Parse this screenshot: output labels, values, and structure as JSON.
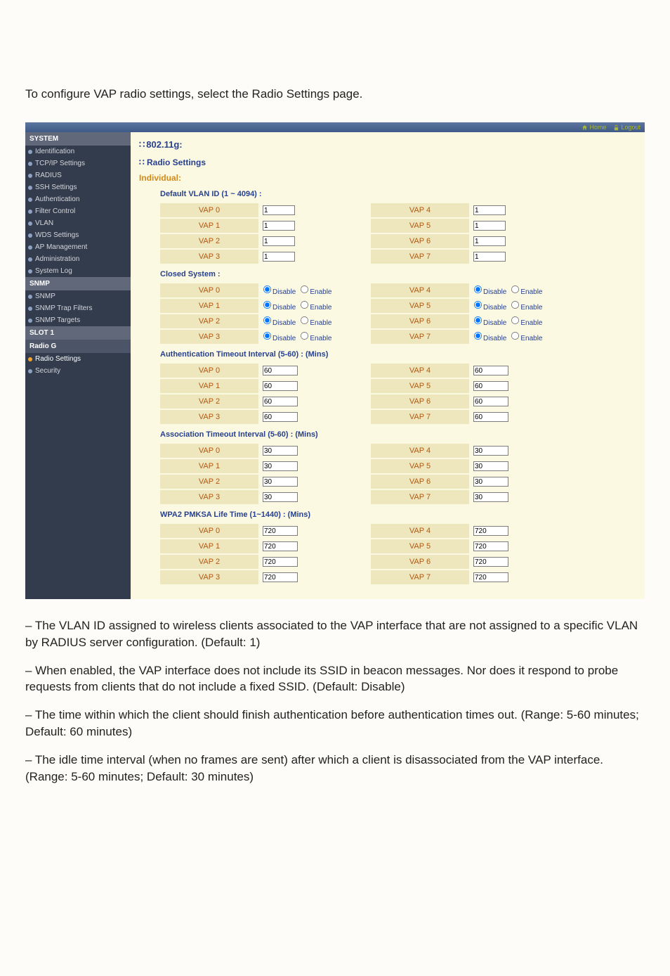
{
  "intro": "To configure VAP radio settings, select the Radio Settings page.",
  "topnav": {
    "home": "Home",
    "logout": "Logout"
  },
  "sidebar": {
    "groups": [
      {
        "name": "SYSTEM",
        "items": [
          {
            "label": "Identification"
          },
          {
            "label": "TCP/IP Settings"
          },
          {
            "label": "RADIUS"
          },
          {
            "label": "SSH Settings"
          },
          {
            "label": "Authentication"
          },
          {
            "label": "Filter Control"
          },
          {
            "label": "VLAN"
          },
          {
            "label": "WDS Settings"
          },
          {
            "label": "AP Management"
          },
          {
            "label": "Administration"
          },
          {
            "label": "System Log"
          }
        ]
      },
      {
        "name": "SNMP",
        "items": [
          {
            "label": "SNMP"
          },
          {
            "label": "SNMP Trap Filters"
          },
          {
            "label": "SNMP Targets"
          }
        ]
      },
      {
        "name": "SLOT 1",
        "items": []
      },
      {
        "name": "Radio G",
        "sub": true,
        "items": [
          {
            "label": "Radio Settings",
            "active": true
          },
          {
            "label": "Security"
          }
        ]
      }
    ]
  },
  "panel": {
    "title": "802.11g:",
    "subsection": "Radio Settings",
    "individual": "Individual:",
    "vlan_heading": "Default VLAN ID (1 ~ 4094) :",
    "closed_heading": "Closed System :",
    "auth_heading": "Authentication Timeout Interval (5-60) : (Mins)",
    "assoc_heading": "Association Timeout Interval (5-60) : (Mins)",
    "pmksa_heading": "WPA2 PMKSA Life Time (1~1440) : (Mins)",
    "radio": {
      "disable": "Disable",
      "enable": "Enable"
    },
    "vap_labels": [
      "VAP 0",
      "VAP 1",
      "VAP 2",
      "VAP 3",
      "VAP 4",
      "VAP 5",
      "VAP 6",
      "VAP 7"
    ],
    "vlan_values": [
      "1",
      "1",
      "1",
      "1",
      "1",
      "1",
      "1",
      "1"
    ],
    "auth_values": [
      "60",
      "60",
      "60",
      "60",
      "60",
      "60",
      "60",
      "60"
    ],
    "assoc_values": [
      "30",
      "30",
      "30",
      "30",
      "30",
      "30",
      "30",
      "30"
    ],
    "pmksa_values": [
      "720",
      "720",
      "720",
      "720",
      "720",
      "720",
      "720",
      "720"
    ]
  },
  "body_paragraphs": [
    " – The VLAN ID assigned to wireless clients associated to the VAP interface that are not assigned to a specific VLAN by RADIUS server configuration. (Default: 1)",
    " – When enabled, the VAP interface does not include its SSID in beacon messages. Nor does it respond to probe requests from clients that do not include a fixed SSID. (Default: Disable)",
    " – The time within which the client should finish authentication before authentication times out. (Range: 5-60 minutes; Default: 60 minutes)",
    " – The idle time interval (when no frames are sent) after which a client is disassociated from the VAP interface. (Range: 5-60 minutes; Default: 30 minutes)"
  ]
}
